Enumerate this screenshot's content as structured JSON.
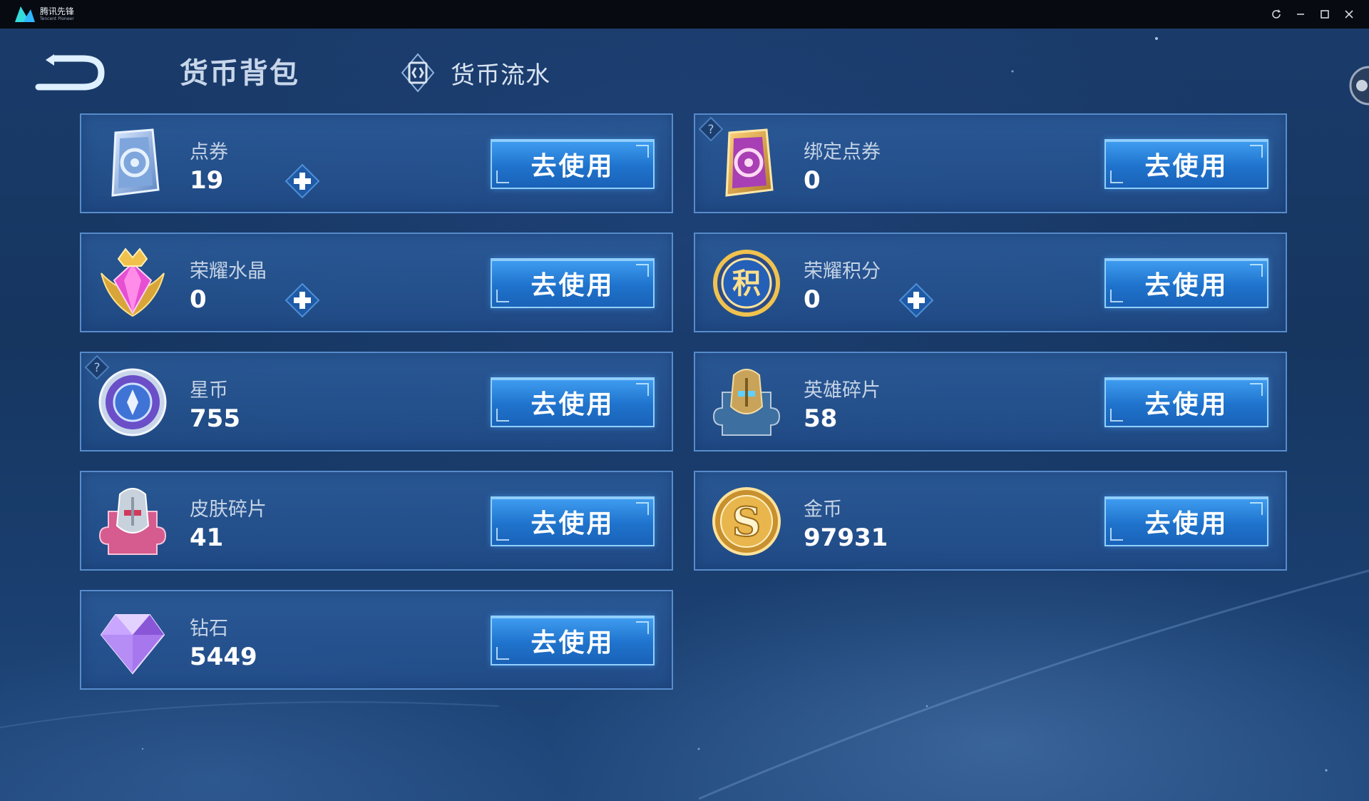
{
  "emulator": {
    "name_line1": "腾讯先锋",
    "name_line2": "Tencent Pioneer"
  },
  "header": {
    "title": "货币背包",
    "flow_tab": "货币流水"
  },
  "use_label": "去使用",
  "currencies": [
    {
      "name": "点券",
      "value": "19",
      "icon": "voucher-card-icon",
      "has_plus": true,
      "has_help": false
    },
    {
      "name": "绑定点券",
      "value": "0",
      "icon": "bound-voucher-card-icon",
      "has_plus": false,
      "has_help": true
    },
    {
      "name": "荣耀水晶",
      "value": "0",
      "icon": "glory-crystal-icon",
      "has_plus": true,
      "has_help": false
    },
    {
      "name": "荣耀积分",
      "value": "0",
      "icon": "glory-points-coin-icon",
      "has_plus": true,
      "has_help": false
    },
    {
      "name": "星币",
      "value": "755",
      "icon": "star-coin-icon",
      "has_plus": false,
      "has_help": true
    },
    {
      "name": "英雄碎片",
      "value": "58",
      "icon": "hero-fragment-icon",
      "has_plus": false,
      "has_help": false
    },
    {
      "name": "皮肤碎片",
      "value": "41",
      "icon": "skin-fragment-icon",
      "has_plus": false,
      "has_help": false
    },
    {
      "name": "金币",
      "value": "97931",
      "icon": "gold-coin-icon",
      "has_plus": false,
      "has_help": false
    },
    {
      "name": "钻石",
      "value": "5449",
      "icon": "diamond-icon",
      "has_plus": false,
      "has_help": false
    }
  ],
  "colors": {
    "button_top": "#3f9ef2",
    "button_bottom": "#1a62b8",
    "card_border": "#6096d7",
    "background": "#163660"
  }
}
